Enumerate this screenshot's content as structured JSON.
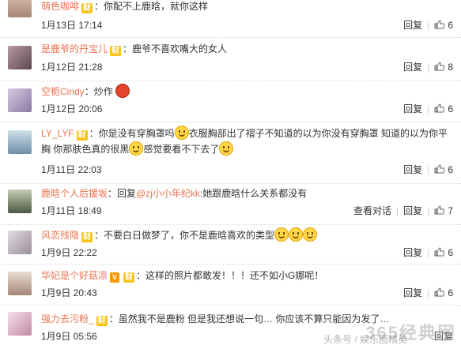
{
  "comments": [
    {
      "user": "萌色咖啡",
      "badge": "财",
      "sep": "：",
      "text": "你配不上鹿晗，就你这样",
      "date": "1月13日 17:14",
      "reply": "回复",
      "likes": "6",
      "avatar_color": "#c9a48e"
    },
    {
      "user": "是鹿爷的丹宝儿",
      "badge": "财",
      "sep": "：",
      "text": "鹿爷不喜欢嘴大的女人",
      "date": "1月12日 21:28",
      "reply": "回复",
      "likes": "8",
      "avatar_color": "#8a6f77"
    },
    {
      "user": "空栀Cindy",
      "sep": "：",
      "text": "炒作",
      "date": "1月12日 20:06",
      "reply": "回复",
      "likes": "6",
      "avatar_color": "#b7a9c9"
    },
    {
      "user": "LY_LYF",
      "badge": "财",
      "sep": "：",
      "text_a": "你是没有穿胸罩吗",
      "text_b": "衣服胸部出了褶子不知道的以为你没有穿胸罩 知道的以为你平",
      "text_c": "胸 你那肤色真的很黑",
      "text_d": "感觉要看不下去了",
      "date": "1月11日 22:03",
      "reply": "回复",
      "likes": "6",
      "avatar_color": "#8fb1c9"
    },
    {
      "user": "鹿晗个人后援坂",
      "sep": "：",
      "pre": "回复",
      "mention": "@zj小小年纪kk",
      "text": ":她跟鹿晗什么关系都没有",
      "date": "1月11日 18:49",
      "view": "查看对话",
      "reply": "回复",
      "likes": "7",
      "avatar_color": "#7d8a70"
    },
    {
      "user": "风恋残隐",
      "badge": "财",
      "sep": "：",
      "text": "不要白日做梦了，你不是鹿晗喜欢的类型",
      "date": "1月9日 22:22",
      "reply": "回复",
      "likes": "6",
      "avatar_color": "#c8c0c8"
    },
    {
      "user": "华妃是个好菇凉",
      "badge": "财",
      "sep": "：",
      "text": "这样的照片都敢发！！！还不如小G娜呢！",
      "date": "1月9日 20:43",
      "reply": "回复",
      "likes": "6",
      "avatar_color": "#d0b6a6"
    },
    {
      "user": "强力去污粉_",
      "badge": "财",
      "sep": "：",
      "text": "虽然我不是鹿粉 但是我还想说一句… 你应该不算只能因为发了…",
      "date": "1月9日 05:56",
      "reply": "回复",
      "likes": "",
      "avatar_color": "#e7c4d6"
    }
  ],
  "watermark": {
    "main": "365经典网",
    "sub": "头条号 / 娱乐圈精英"
  }
}
